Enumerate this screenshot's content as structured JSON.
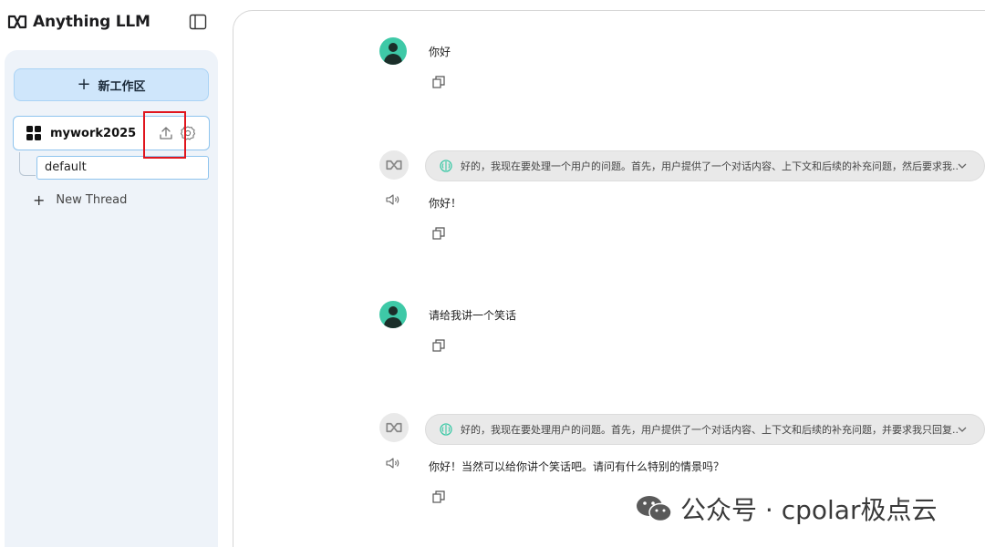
{
  "app": {
    "title": "Anything LLM"
  },
  "sidebar": {
    "new_workspace_label": "新工作区",
    "workspace": {
      "name": "mywork2025"
    },
    "threads": [
      {
        "label": "default"
      }
    ],
    "new_thread_label": "New Thread"
  },
  "chat": {
    "messages": [
      {
        "role": "user",
        "text": "你好"
      },
      {
        "role": "assistant",
        "thought": "好的，我现在要处理一个用户的问题。首先，用户提供了一个对话内容、上下文和后续的补充问题，然后要求我...",
        "text": "你好！"
      },
      {
        "role": "user",
        "text": "请给我讲一个笑话"
      },
      {
        "role": "assistant",
        "thought": "好的，我现在要处理用户的问题。首先，用户提供了一个对话内容、上下文和后续的补充问题，并要求我只回复...",
        "text": "你好！当然可以给你讲个笑话吧。请问有什么特别的情景吗？"
      }
    ]
  },
  "watermark": {
    "text": "公众号 · cpolar极点云"
  },
  "colors": {
    "accent": "#3ec9a7",
    "highlight_box": "#e0161e",
    "new_workspace_bg": "#cfe6fb"
  },
  "icons": [
    "sidebar-toggle-icon",
    "upload-icon",
    "gear-icon",
    "copy-icon",
    "speaker-icon",
    "brain-icon",
    "chevron-down-icon",
    "wechat-icon"
  ]
}
